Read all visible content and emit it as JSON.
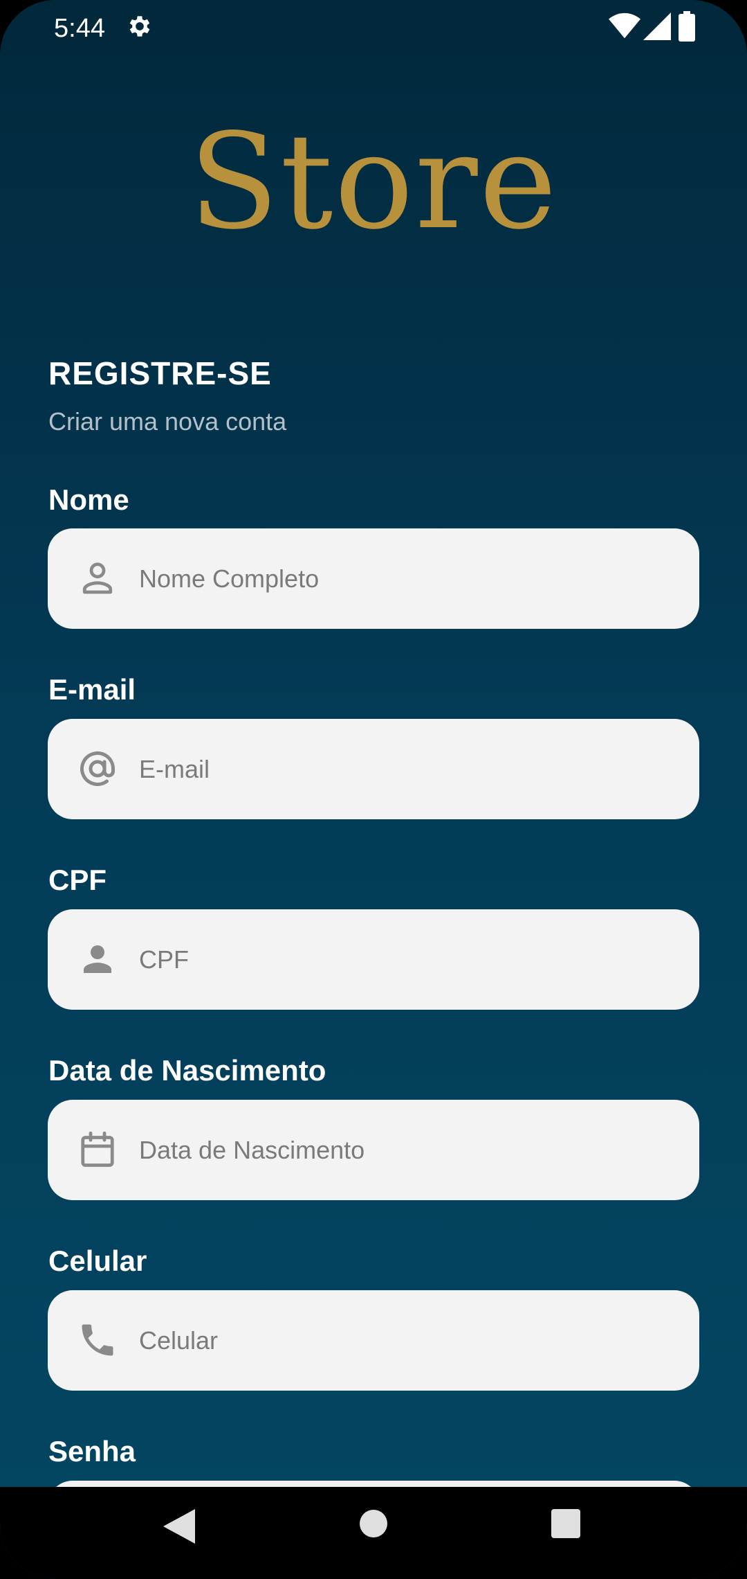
{
  "status_bar": {
    "time": "5:44"
  },
  "logo": {
    "text": "Store"
  },
  "header": {
    "title": "REGISTRE-SE",
    "subtitle": "Criar uma nova conta"
  },
  "form": {
    "fields": [
      {
        "label": "Nome",
        "placeholder": "Nome Completo",
        "icon": "person-outline-icon"
      },
      {
        "label": "E-mail",
        "placeholder": "E-mail",
        "icon": "at-sign-icon"
      },
      {
        "label": "CPF",
        "placeholder": "CPF",
        "icon": "person-filled-icon"
      },
      {
        "label": "Data de Nascimento",
        "placeholder": "Data de Nascimento",
        "icon": "calendar-icon"
      },
      {
        "label": "Celular",
        "placeholder": "Celular",
        "icon": "phone-icon"
      },
      {
        "label": "Senha",
        "placeholder": "",
        "icon": ""
      }
    ]
  },
  "colors": {
    "background": "#033a55",
    "accent": "#b8913c",
    "input_bg": "#f3f3f3"
  }
}
